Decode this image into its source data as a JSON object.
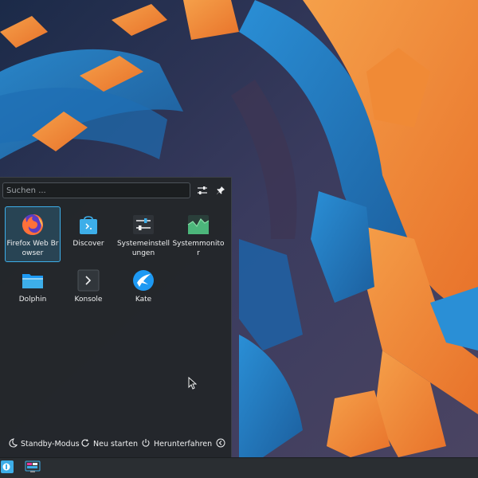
{
  "launcher": {
    "search": {
      "placeholder": "Suchen ..."
    },
    "apps": [
      {
        "label": "Firefox Web Browser",
        "icon": "firefox-icon",
        "selected": true
      },
      {
        "label": "Discover",
        "icon": "discover-icon"
      },
      {
        "label": "Systemeinstellungen",
        "icon": "system-settings-icon"
      },
      {
        "label": "Systemmonitor",
        "icon": "system-monitor-icon"
      },
      {
        "label": "Dolphin",
        "icon": "dolphin-icon"
      },
      {
        "label": "Konsole",
        "icon": "konsole-icon"
      },
      {
        "label": "Kate",
        "icon": "kate-icon"
      }
    ],
    "footer": {
      "standby": "Standby-Modus",
      "restart": "Neu starten",
      "shutdown": "Herunterfahren"
    }
  },
  "colors": {
    "accent": "#3daee9",
    "panel": "#23262a",
    "text": "#eff0f1"
  }
}
